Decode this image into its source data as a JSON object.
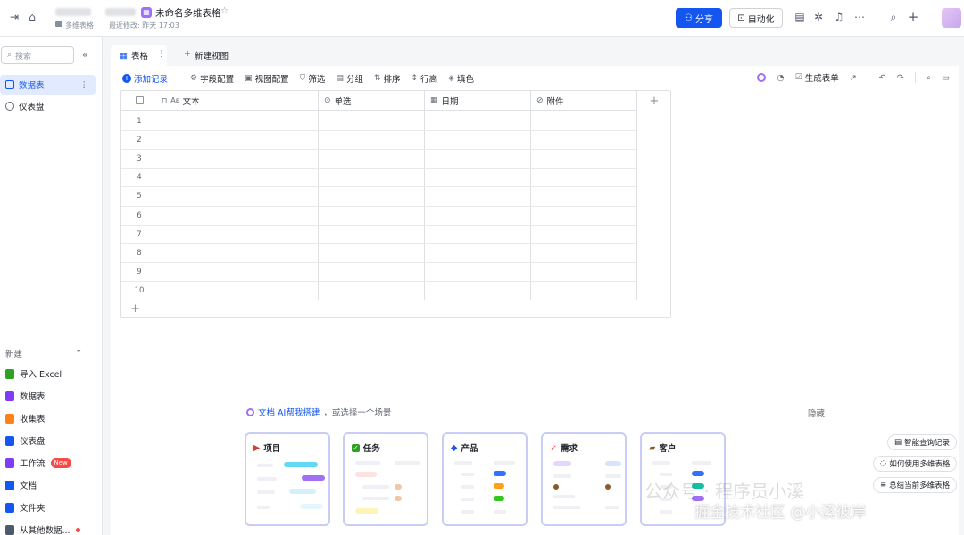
{
  "topbar": {
    "doc_title": "未命名多维表格",
    "breadcrumb_folder": "多维表格",
    "last_modified": "最近修改: 昨天 17:03",
    "share_label": "分享",
    "automation_label": "自动化"
  },
  "sidebar": {
    "search_placeholder": "搜索",
    "items": [
      {
        "label": "数据表",
        "more": "⋮"
      },
      {
        "label": "仪表盘"
      }
    ],
    "new_section_label": "新建",
    "new_items": [
      {
        "label": "导入 Excel",
        "color": "#2ea121"
      },
      {
        "label": "数据表",
        "color": "#7f3bf5"
      },
      {
        "label": "收集表",
        "color": "#ff811a"
      },
      {
        "label": "仪表盘",
        "color": "#1456f0"
      },
      {
        "label": "工作流",
        "badge": "New",
        "color": "#7f3bf5"
      },
      {
        "label": "文档",
        "color": "#1456f0"
      },
      {
        "label": "文件夹",
        "color": "#1456f0"
      },
      {
        "label": "从其他数据..."
      }
    ]
  },
  "view_tabs": {
    "active_tab": "表格",
    "new_view": "新建视图"
  },
  "toolbar": {
    "add_record": "添加记录",
    "field_config": "字段配置",
    "view_config": "视图配置",
    "filter": "筛选",
    "group": "分组",
    "sort": "排序",
    "row_height": "行高",
    "fill_color": "填色",
    "generate_form": "生成表单"
  },
  "grid": {
    "columns": [
      {
        "label": "文本",
        "icon": "text-icon"
      },
      {
        "label": "单选",
        "icon": "single-select-icon"
      },
      {
        "label": "日期",
        "icon": "date-icon"
      },
      {
        "label": "附件",
        "icon": "attachment-icon"
      }
    ],
    "row_numbers": [
      "1",
      "2",
      "3",
      "4",
      "5",
      "6",
      "7",
      "8",
      "9",
      "10"
    ],
    "add_column": "+",
    "add_row": "+"
  },
  "scenes": {
    "prompt_link": "文档 AI帮我搭建",
    "prompt_rest": "，或选择一个场景",
    "hide_label": "隐藏",
    "cards": [
      {
        "title": "项目",
        "icon": "flag-icon",
        "color": "#d83931"
      },
      {
        "title": "任务",
        "icon": "check-icon",
        "color": "#2ea121"
      },
      {
        "title": "产品",
        "icon": "diamond-icon",
        "color": "#1456f0"
      },
      {
        "title": "需求",
        "icon": "rocket-icon",
        "color": "#f54a45"
      },
      {
        "title": "客户",
        "icon": "briefcase-icon",
        "color": "#8a5a2b"
      }
    ]
  },
  "help_buttons": {
    "query_log": "智能查询记录",
    "how_to": "如何使用多维表格",
    "summarize": "总结当前多维表格"
  },
  "watermark": {
    "line1": "公众号 · 程序员小溪",
    "line2": "掘金技术社区 @小溪彼岸"
  }
}
